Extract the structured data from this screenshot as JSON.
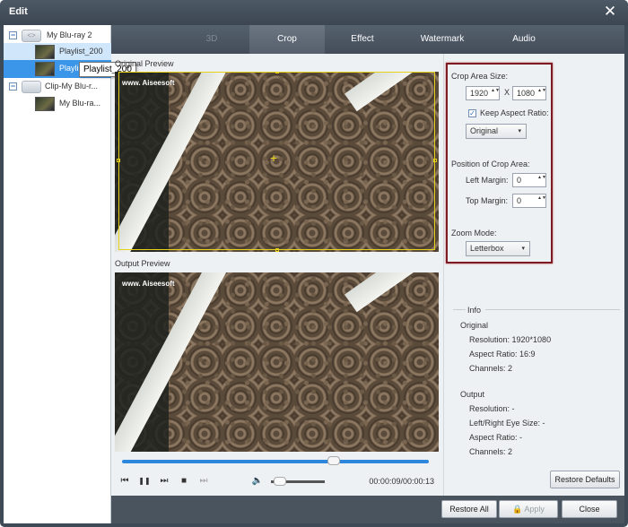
{
  "window": {
    "title": "Edit",
    "close_glyph": "✕"
  },
  "tree": {
    "items": [
      {
        "label": "My Blu-ray 2",
        "exp": "−",
        "disc": "<>"
      },
      {
        "label": "Playlist_200"
      },
      {
        "label": "Playlist_200"
      },
      {
        "label": "Clip-My Blu-r...",
        "exp": "−"
      },
      {
        "label": "My Blu-ra..."
      }
    ],
    "tooltip": "Playlist_200"
  },
  "tabs": [
    {
      "label": "3D",
      "state": "disabled"
    },
    {
      "label": "Crop",
      "state": "active"
    },
    {
      "label": "Effect",
      "state": "normal"
    },
    {
      "label": "Watermark",
      "state": "normal"
    },
    {
      "label": "Audio",
      "state": "normal"
    }
  ],
  "preview": {
    "original_label": "Original Preview",
    "output_label": "Output Preview",
    "watermark_text": "www.  Aiseesoft",
    "crosshair": "+"
  },
  "player": {
    "progress": 0.69,
    "volume": 0.08,
    "time": "00:00:09/00:00:13",
    "icons": {
      "prev": "⏮",
      "pause": "❚❚",
      "next": "⏭",
      "stop": "■",
      "end": "⏭",
      "volume": "🔈"
    }
  },
  "crop": {
    "area_size_label": "Crop Area Size:",
    "width": "1920",
    "height": "1080",
    "x_sep": "X",
    "keep_aspect_label": "Keep Aspect Ratio:",
    "keep_aspect_checked": true,
    "check_glyph": "✓",
    "aspect_value": "Original",
    "position_label": "Position of Crop Area:",
    "left_margin_label": "Left Margin:",
    "left_margin": "0",
    "top_margin_label": "Top Margin:",
    "top_margin": "0",
    "zoom_mode_label": "Zoom Mode:",
    "zoom_mode": "Letterbox",
    "caret": "▾",
    "spin_arrows": "▲▼"
  },
  "info": {
    "heading": "Info",
    "original_heading": "Original",
    "original_resolution": "Resolution:  1920*1080",
    "original_aspect": "Aspect Ratio:  16:9",
    "original_channels": "Channels:  2",
    "output_heading": "Output",
    "output_resolution": "Resolution:  -",
    "output_eye": "Left/Right Eye Size:  -",
    "output_aspect": "Aspect Ratio:  -",
    "output_channels": "Channels:  2"
  },
  "buttons": {
    "restore_defaults": "Restore Defaults",
    "restore_all": "Restore All",
    "apply": "Apply",
    "close": "Close"
  },
  "colors": {
    "accent": "#2d88dd",
    "highlight_box": "#7e1a22",
    "crop_frame": "#e7d21a"
  }
}
